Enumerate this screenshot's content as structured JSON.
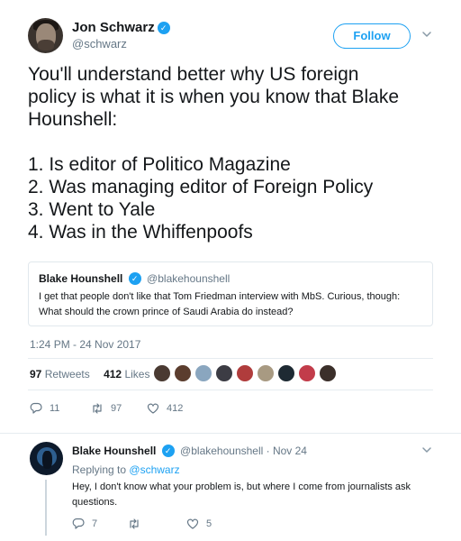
{
  "author": {
    "name": "Jon Schwarz",
    "handle": "@schwarz",
    "verified": true
  },
  "follow_label": "Follow",
  "tweet": {
    "lines": [
      "You'll understand better why US foreign",
      "policy is what it is when you know that Blake",
      "Hounshell:",
      "1. Is editor of Politico Magazine",
      "2. Was managing editor of Foreign Policy",
      "3. Went to Yale",
      "4. Was in the Whiffenpoofs"
    ],
    "timestamp": "1:24 PM - 24 Nov 2017"
  },
  "quoted": {
    "name": "Blake Hounshell",
    "handle": "@blakehounshell",
    "text_line1": "I get that people don't like that Tom Friedman interview with MbS. Curious, though:",
    "text_line2": "What should the crown prince of Saudi Arabia do instead?"
  },
  "stats": {
    "retweets_count": "97",
    "retweets_label": "Retweets",
    "likes_count": "412",
    "likes_label": "Likes"
  },
  "actions": {
    "replies": "11",
    "retweets": "97",
    "likes": "412"
  },
  "reply": {
    "name": "Blake Hounshell",
    "handle_date": "@blakehounshell · Nov 24",
    "replying_prefix": "Replying to",
    "replying_handle": "@schwarz",
    "text_line1": "Hey, I don't know what your problem is, but where I come from journalists ask",
    "text_line2": "questions.",
    "replies": "7",
    "retweets": "",
    "likes": "5"
  },
  "colors": {
    "accent": "#1da1f2",
    "text": "#14171a",
    "muted": "#657786",
    "border": "#e6ecf0"
  },
  "icons": {
    "verified": "verified-badge-icon",
    "caret": "chevron-down-icon",
    "reply": "reply-icon",
    "retweet": "retweet-icon",
    "like": "heart-icon"
  }
}
